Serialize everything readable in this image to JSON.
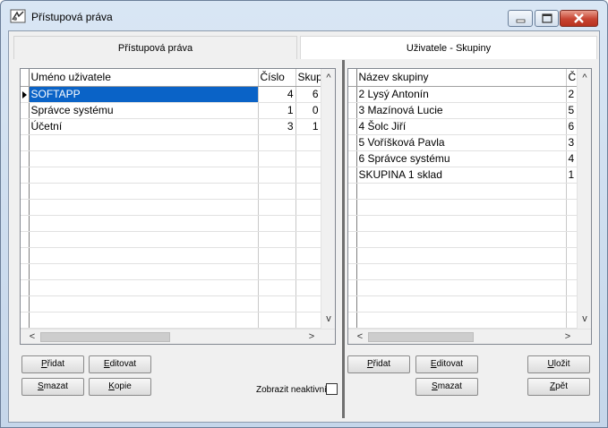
{
  "window": {
    "title": "Přístupová práva"
  },
  "tabs": [
    "Přístupová práva",
    "Uživatele - Skupiny"
  ],
  "users_grid": {
    "columns": [
      "Uméno uživatele",
      "Číslo",
      "Skup"
    ],
    "rows": [
      {
        "name": "SOFTAPP",
        "cislo": "4",
        "skup": "6"
      },
      {
        "name": "Správce systému",
        "cislo": "1",
        "skup": "0"
      },
      {
        "name": "Účetní",
        "cislo": "3",
        "skup": "1"
      }
    ]
  },
  "groups_grid": {
    "columns": [
      "Název skupiny",
      "Č"
    ],
    "rows": [
      {
        "name": "2 Lysý Antonín",
        "c": "2"
      },
      {
        "name": "3 Mazínová Lucie",
        "c": "5"
      },
      {
        "name": "4 Šolc Jiří",
        "c": "6"
      },
      {
        "name": "5 Voříšková Pavla",
        "c": "3"
      },
      {
        "name": "6 Správce systému",
        "c": "4"
      },
      {
        "name": "SKUPINA 1 sklad",
        "c": "1"
      }
    ]
  },
  "buttons": {
    "pridat": {
      "first": "P",
      "rest": "řidat"
    },
    "editovat": {
      "first": "E",
      "rest": "ditovat"
    },
    "smazat": {
      "first": "S",
      "rest": "mazat"
    },
    "kopie": {
      "first": "K",
      "rest": "opie"
    },
    "pridat2": {
      "first": "P",
      "rest": "řidat"
    },
    "editovat2": {
      "first": "E",
      "rest": "ditovat"
    },
    "smazat2": {
      "first": "S",
      "rest": "mazat"
    },
    "ulozit": {
      "first": "U",
      "rest": "ložit"
    },
    "zpet": {
      "first": "Z",
      "rest": "pět"
    }
  },
  "show_inactive_label": "Zobrazit neaktivní",
  "show_inactive_checked": false
}
